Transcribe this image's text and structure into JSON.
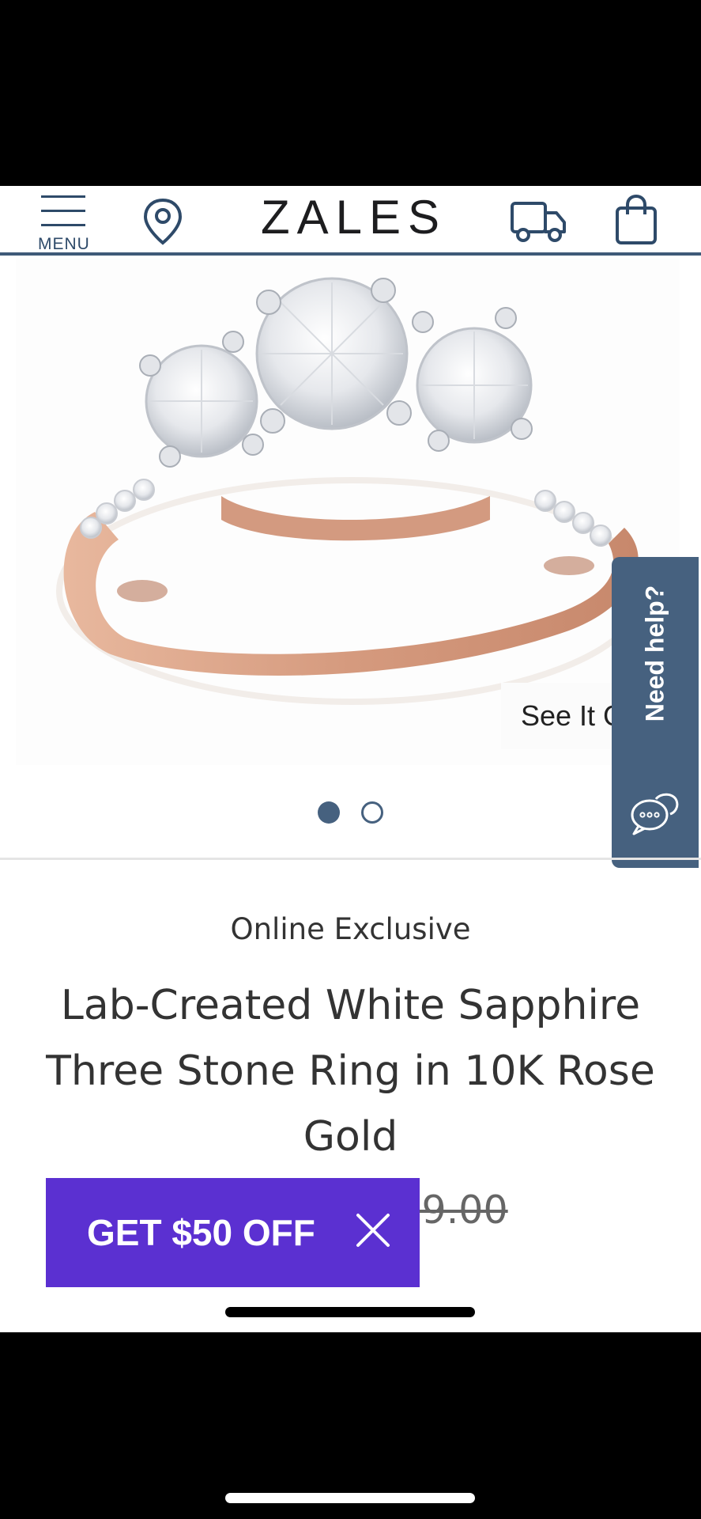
{
  "header": {
    "menu_label": "MENU",
    "logo": "ZALES"
  },
  "hero": {
    "see_it_label": "See It On",
    "help_label": "Need help?",
    "carousel_dots": 2,
    "active_slide": 1
  },
  "product": {
    "badge": "Online Exclusive",
    "title": "Lab-Created White Sapphire Three Stone Ring in 10K Rose Gold",
    "price": "$349.00"
  },
  "promo": {
    "label": "GET $50 OFF"
  },
  "colors": {
    "brand_navy": "#46617f",
    "promo_purple": "#5b30d1",
    "rose_gold": "#d9a58c"
  },
  "icons": [
    "menu-icon",
    "location-pin-icon",
    "truck-icon",
    "shopping-bag-icon",
    "chat-bubbles-icon",
    "close-icon"
  ]
}
